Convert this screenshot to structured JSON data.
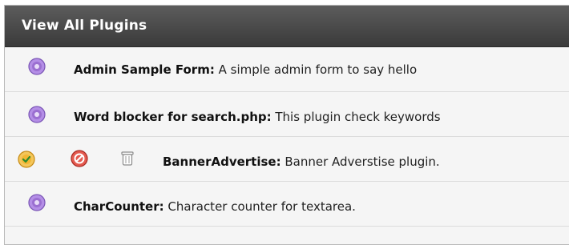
{
  "panel": {
    "title": "View All Plugins"
  },
  "plugins": [
    {
      "name": "Admin Sample Form:",
      "description": "A simple admin form to say hello",
      "status_icon": "inactive-plugin-icon"
    },
    {
      "name": "Word blocker for search.php:",
      "description": "This plugin check keywords",
      "status_icon": "inactive-plugin-icon"
    },
    {
      "name": "BannerAdvertise:",
      "description": "Banner Adverstise plugin.",
      "status_icon": "active-plugin-icon",
      "actions": [
        "deactivate-icon",
        "delete-icon"
      ]
    },
    {
      "name": "CharCounter:",
      "description": "Character counter for textarea.",
      "status_icon": "inactive-plugin-icon"
    }
  ],
  "colors": {
    "header_bg": "#4a4a4a",
    "inactive_icon": "#9b6fd1",
    "active_icon": "#f2b632",
    "deactivate_icon": "#d6423a"
  }
}
